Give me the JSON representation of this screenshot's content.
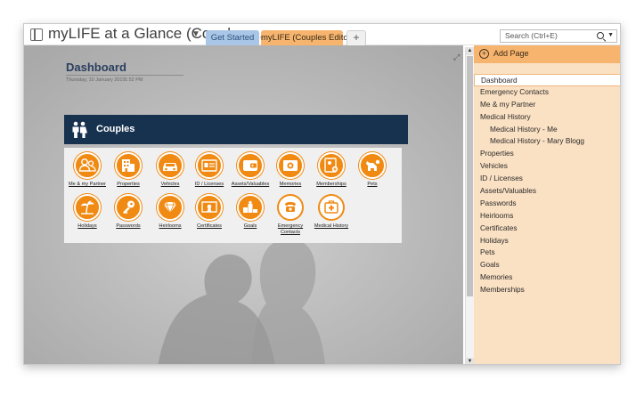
{
  "app": {
    "notebook_title": "myLIFE at a Glance (Couples ...",
    "notebook_caret": "▼"
  },
  "tabs": [
    {
      "label": "Get Started",
      "color": "#a9c6e6"
    },
    {
      "label": "myLIFE (Couples Editon)",
      "color": "#f6b46f",
      "active": true
    },
    {
      "label": "+"
    }
  ],
  "search": {
    "placeholder": "Search (Ctrl+E)"
  },
  "page": {
    "title": "Dashboard",
    "date": "Thursday, 10 January 2019",
    "time": "1:52 PM",
    "banner_title": "Couples",
    "banner_color": "#17324f",
    "accent_color": "#f08a13",
    "tiles_row1": [
      {
        "label": "Me & my Partner",
        "icon": "people-icon"
      },
      {
        "label": "Properties",
        "icon": "building-icon"
      },
      {
        "label": "Vehicles",
        "icon": "car-icon"
      },
      {
        "label": "ID / Licenses",
        "icon": "id-card-icon"
      },
      {
        "label": "Assets/Valuables",
        "icon": "wallet-icon"
      },
      {
        "label": "Memories",
        "icon": "photo-icon"
      },
      {
        "label": "Memberships",
        "icon": "membership-card-icon"
      },
      {
        "label": "Pets",
        "icon": "dog-icon"
      }
    ],
    "tiles_row2": [
      {
        "label": "Holidays",
        "icon": "palm-tree-icon"
      },
      {
        "label": "Passwords",
        "icon": "key-icon"
      },
      {
        "label": "Heirlooms",
        "icon": "diamond-icon"
      },
      {
        "label": "Certificates",
        "icon": "certificate-icon"
      },
      {
        "label": "Goals",
        "icon": "podium-icon"
      },
      {
        "label": "Emergency Contacts",
        "icon": "phone-icon"
      },
      {
        "label": "Medical History",
        "icon": "medical-kit-icon"
      }
    ]
  },
  "sidebar": {
    "add_page_label": "Add Page",
    "pages": [
      {
        "label": "Dashboard",
        "selected": true
      },
      {
        "label": "Emergency Contacts"
      },
      {
        "label": "Me & my Partner"
      },
      {
        "label": "Medical History"
      },
      {
        "label": "Medical History - Me",
        "sub": true
      },
      {
        "label": "Medical History - Mary Blogg",
        "sub": true
      },
      {
        "label": "Properties"
      },
      {
        "label": "Vehicles"
      },
      {
        "label": "ID / Licenses"
      },
      {
        "label": "Assets/Valuables"
      },
      {
        "label": "Passwords"
      },
      {
        "label": "Heirlooms"
      },
      {
        "label": "Certificates"
      },
      {
        "label": "Holidays"
      },
      {
        "label": "Pets"
      },
      {
        "label": "Goals"
      },
      {
        "label": "Memories"
      },
      {
        "label": "Memberships"
      }
    ]
  }
}
